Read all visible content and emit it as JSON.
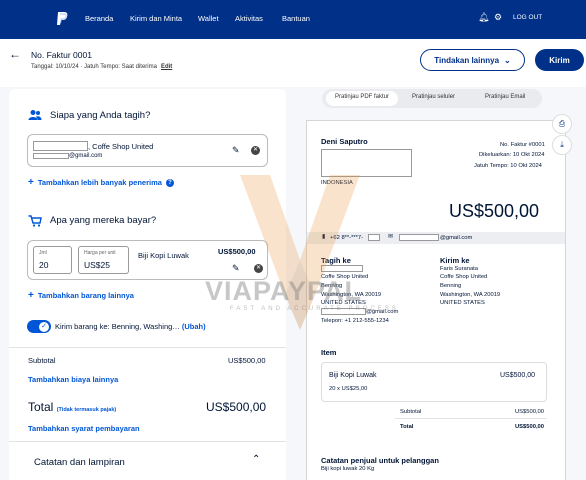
{
  "nav": {
    "links": [
      "Beranda",
      "Kirim dan Minta",
      "Wallet",
      "Aktivitas",
      "Bantuan"
    ],
    "logout": "LOG OUT"
  },
  "header": {
    "invoice_no": "No. Faktur 0001",
    "meta": "Tanggal: 10/10/24 · Jatuh Tempo: Saat diterima",
    "edit": "Edit",
    "more_actions": "Tindakan lainnya",
    "send": "Kirim"
  },
  "recipient": {
    "title": "Siapa yang Anda tagih?",
    "name": ", Coffe Shop United",
    "email": "@gmail.com",
    "add_more": "Tambahkan lebih banyak penerima"
  },
  "items": {
    "title": "Apa yang mereka bayar?",
    "qty_label": "Jml",
    "qty": "20",
    "price_label": "Harga per unit",
    "price": "US$25",
    "name": "Biji Kopi Luwak",
    "amount": "US$500,00",
    "add_item": "Tambahkan barang lainnya"
  },
  "shipping": {
    "text": "Kirim barang ke: Benning, Washing…",
    "change": "(Ubah)"
  },
  "totals": {
    "subtotal_label": "Subtotal",
    "subtotal": "US$500,00",
    "add_fee": "Tambahkan biaya lainnya",
    "total_label": "Total",
    "total_note": "(Tidak termasuk pajak)",
    "total": "US$500,00",
    "add_terms": "Tambahkan syarat pembayaran",
    "notes_title": "Catatan dan lampiran"
  },
  "tabs": [
    "Pratinjau PDF faktur",
    "Pratinjau seluler",
    "Pratinjau Email"
  ],
  "preview": {
    "seller": "Deni Saputro",
    "country": "INDONESIA",
    "invoice_no": "No. Faktur #0001",
    "issued": "Dikeluarkan: 10 Okt 2024",
    "due": "Jatuh Tempo: 10 Okt 2024",
    "amount": "US$500,00",
    "phone": "+62 8**-***7-",
    "email": "@gmail.com",
    "bill_to_label": "Tagih ke",
    "bill_to": [
      "Coffe Shop United",
      "Benning",
      "Washington, WA 20019",
      "UNITED STATES"
    ],
    "bill_email": "@gmail.com",
    "bill_phone": "Telepon: +1 212-555-1234",
    "ship_to_label": "Kirim ke",
    "ship_to": [
      "Faris Suranata",
      "Coffe Shop United",
      "Benning",
      "Washington, WA 20019",
      "UNITED STATES"
    ],
    "items_label": "Item",
    "item_name": "Biji Kopi Luwak",
    "item_detail": "20 x US$25,00",
    "item_amount": "US$500,00",
    "subtotal_label": "Subtotal",
    "subtotal": "US$500,00",
    "total_label": "Total",
    "total": "US$500,00",
    "notes_label": "Catatan penjual untuk pelanggan",
    "notes": "Biji kopi luwak 20 Kg"
  },
  "watermark": {
    "text": "VIAPAYPAL",
    "sub": "FAST AND ACCURATE PROCESS"
  },
  "colors": {
    "nav": "#003087",
    "link": "#0056d6",
    "watermark": "#e8943a"
  }
}
